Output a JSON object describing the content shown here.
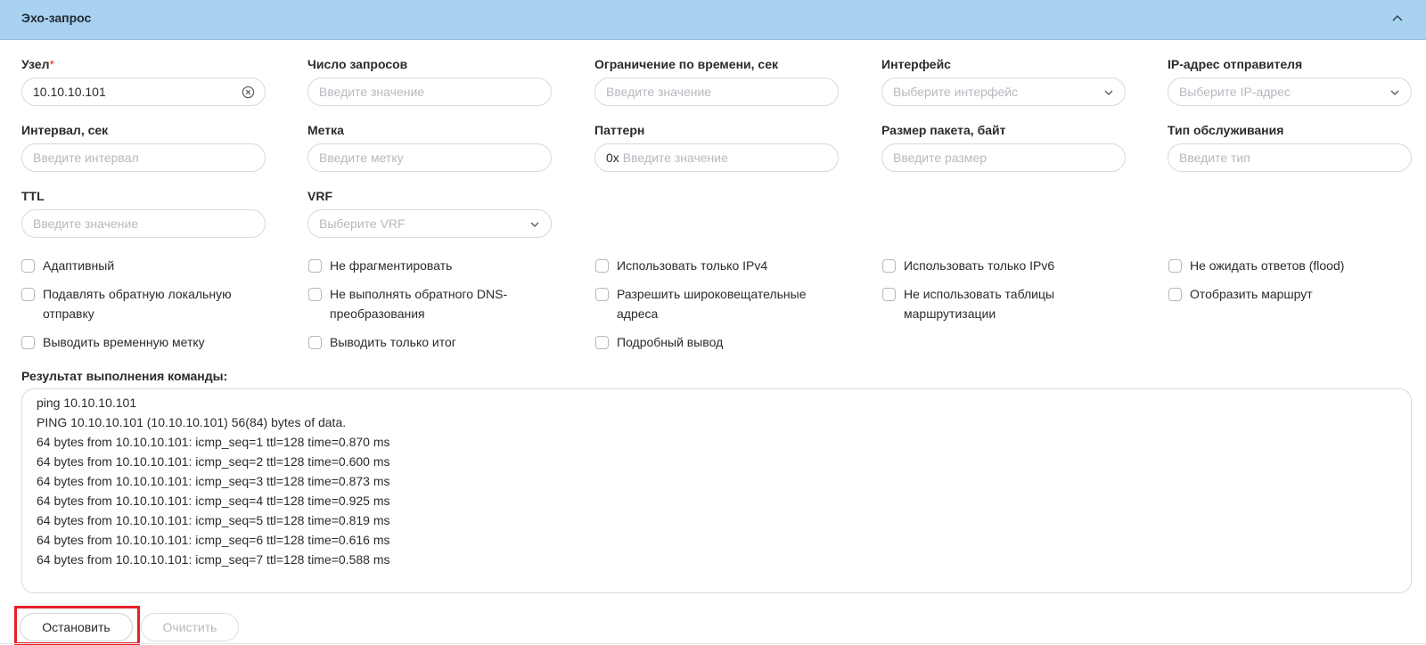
{
  "header": {
    "title": "Эхо-запрос"
  },
  "fields": {
    "host": {
      "label": "Узел",
      "required_mark": "*",
      "value": "10.10.10.101"
    },
    "count": {
      "label": "Число запросов",
      "placeholder": "Введите значение"
    },
    "timeout": {
      "label": "Ограничение по времени, сек",
      "placeholder": "Введите значение"
    },
    "interface": {
      "label": "Интерфейс",
      "placeholder": "Выберите интерфейс"
    },
    "source_ip": {
      "label": "IP-адрес отправителя",
      "placeholder": "Выберите IP-адрес"
    },
    "interval": {
      "label": "Интервал, сек",
      "placeholder": "Введите интервал"
    },
    "mark": {
      "label": "Метка",
      "placeholder": "Введите метку"
    },
    "pattern": {
      "label": "Паттерн",
      "prefix": "0x",
      "placeholder": "Введите значение"
    },
    "packet_size": {
      "label": "Размер пакета, байт",
      "placeholder": "Введите размер"
    },
    "tos": {
      "label": "Тип обслуживания",
      "placeholder": "Введите тип"
    },
    "ttl": {
      "label": "TTL",
      "placeholder": "Введите значение"
    },
    "vrf": {
      "label": "VRF",
      "placeholder": "Выберите VRF"
    }
  },
  "checkboxes": {
    "adaptive": "Адаптивный",
    "no_fragment": "Не фрагментировать",
    "ipv4_only": "Использовать только IPv4",
    "ipv6_only": "Использовать только IPv6",
    "flood": "Не ожидать ответов (flood)",
    "suppress_loopback_1": "Подавлять обратную локальную",
    "suppress_loopback_2": "отправку",
    "no_dns_1": "Не выполнять обратного DNS-",
    "no_dns_2": "преобразования",
    "broadcast_1": "Разрешить широковещательные",
    "broadcast_2": "адреса",
    "no_routing_1": "Не использовать таблицы",
    "no_routing_2": "маршрутизации",
    "show_route": "Отобразить маршрут",
    "timestamp": "Выводить временную метку",
    "summary_only": "Выводить только итог",
    "verbose": "Подробный вывод"
  },
  "result": {
    "label": "Результат выполнения команды:",
    "lines": [
      "ping 10.10.10.101",
      "PING 10.10.10.101 (10.10.10.101) 56(84) bytes of data.",
      "64 bytes from 10.10.10.101: icmp_seq=1 ttl=128 time=0.870 ms",
      "64 bytes from 10.10.10.101: icmp_seq=2 ttl=128 time=0.600 ms",
      "64 bytes from 10.10.10.101: icmp_seq=3 ttl=128 time=0.873 ms",
      "64 bytes from 10.10.10.101: icmp_seq=4 ttl=128 time=0.925 ms",
      "64 bytes from 10.10.10.101: icmp_seq=5 ttl=128 time=0.819 ms",
      "64 bytes from 10.10.10.101: icmp_seq=6 ttl=128 time=0.616 ms",
      "64 bytes from 10.10.10.101: icmp_seq=7 ttl=128 time=0.588 ms"
    ]
  },
  "buttons": {
    "stop": "Остановить",
    "clear": "Очистить"
  },
  "colors": {
    "header_bg": "#a9d1f0",
    "required": "#e03232",
    "highlight": "#e8202a"
  }
}
